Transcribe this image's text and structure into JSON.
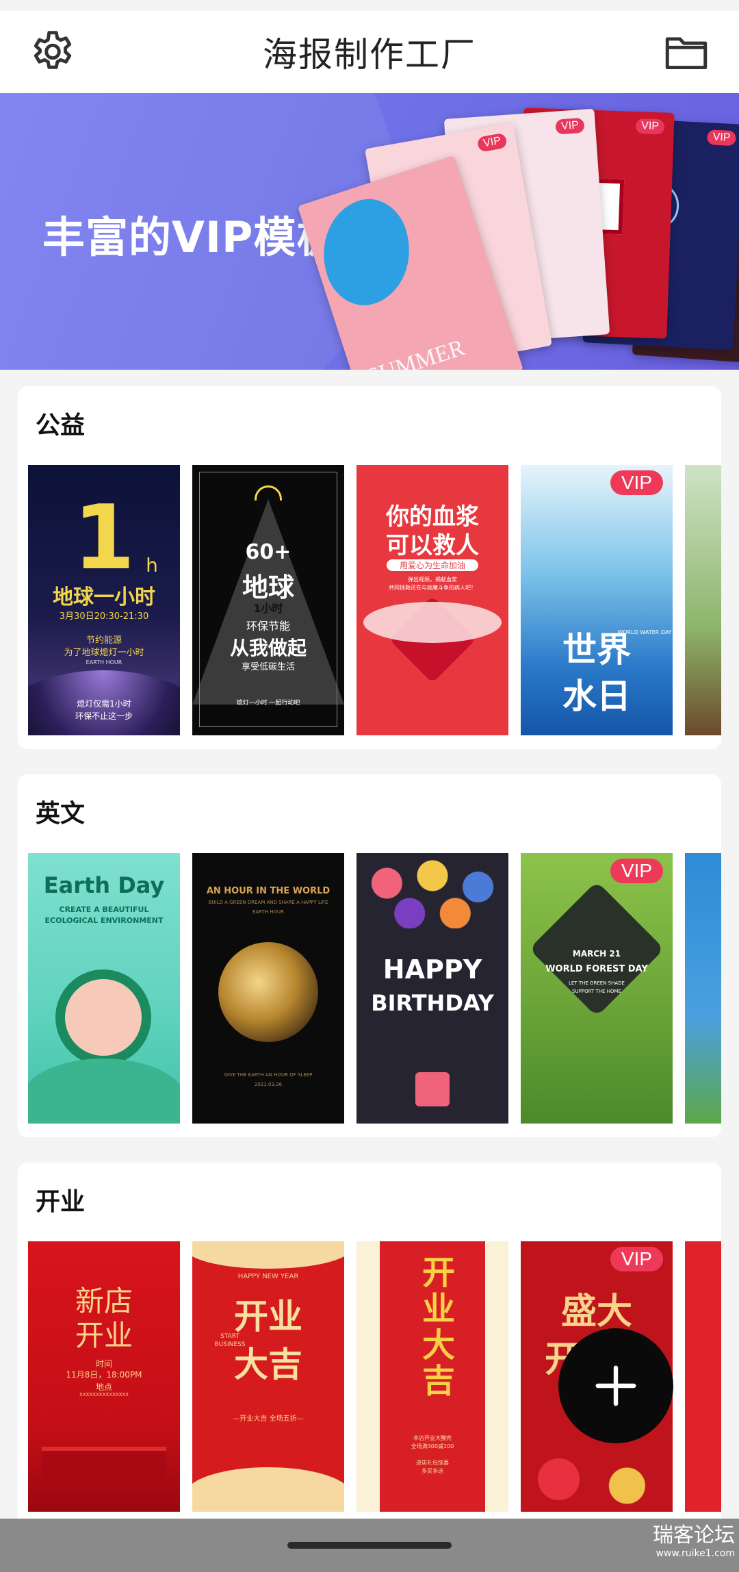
{
  "app": {
    "title": "海报制作工厂"
  },
  "banner": {
    "headline": "丰富的VIP模板",
    "vip_badge": "VIP"
  },
  "sections": [
    {
      "title": "公益",
      "cards": [
        {
          "name": "earth-hour",
          "big": "1",
          "small": "h",
          "line1": "地球一小时",
          "date": "3月30日20:30-21:30",
          "sub1": "节约能源",
          "sub2": "为了地球熄灯一小时",
          "tag": "EARTH HOUR",
          "foot1": "熄灯仅需1小时",
          "foot2": "环保不止这一步"
        },
        {
          "name": "sixty-plus",
          "l1": "60+",
          "l2": "地球",
          "l3": "1小时",
          "l4": "环保节能",
          "l5": "从我做起",
          "l6": "享受低碳生活",
          "l7": "熄灯一小时 一起行动吧"
        },
        {
          "name": "blood-donation",
          "l1": "你的血浆",
          "l2": "可以救人",
          "l3": "用爱心为生命加油",
          "l4": "弹出视频，揭献血浆",
          "l5": "共同拯救还在与病魔斗争的病人吧！"
        },
        {
          "name": "world-water-day",
          "vip": "VIP",
          "l1": "世界",
          "l2": "水日",
          "side": "WORLD WATER DAY"
        }
      ]
    },
    {
      "title": "英文",
      "cards": [
        {
          "name": "earth-day",
          "l1": "Earth Day",
          "l2": "CREATE A BEAUTIFUL",
          "l3": "ECOLOGICAL ENVIRONMENT"
        },
        {
          "name": "hour-in-world",
          "l1": "AN HOUR IN THE WORLD",
          "l2": "BUILD A GREEN DREAM AND SHARE A HAPPY LIFE",
          "l3": "EARTH HOUR",
          "l4": "GIVE THE EARTH AN HOUR OF SLEEP",
          "l5": "2021.03.26"
        },
        {
          "name": "happy-birthday",
          "l1": "HAPPY",
          "l2": "BIRTHDAY"
        },
        {
          "name": "world-forest-day",
          "vip": "VIP",
          "l1": "MARCH 21",
          "l2": "WORLD FOREST DAY",
          "l3": "LET THE GREEN SHADE",
          "l4": "SUPPORT THE HOME"
        }
      ]
    },
    {
      "title": "开业",
      "cards": [
        {
          "name": "new-store",
          "l1": "新店",
          "l2": "开业",
          "l3": "时间",
          "l4": "11月8日，18:00PM",
          "l5": "地点",
          "l6": "XXXXXXXXXXXXXXX"
        },
        {
          "name": "grand-opening-1",
          "l0": "HAPPY NEW YEAR",
          "l1": "开业",
          "l2": "大吉",
          "l3": "START",
          "l4": "BUSINESS",
          "l5": "—开业大吉 全场五折—"
        },
        {
          "name": "grand-opening-2",
          "l1": "开业大吉",
          "l2": "本店开业大酬宾",
          "l3": "全场满300减100",
          "l4": "进店礼包惊喜",
          "l5": "多买多送"
        },
        {
          "name": "grand-open-vip",
          "vip": "VIP",
          "l1": "盛大",
          "l2": "开"
        }
      ]
    }
  ],
  "watermark": {
    "title": "瑞客论坛",
    "url": "www.ruike1.com"
  },
  "icons": {
    "settings": "gear-icon",
    "files": "folder-icon",
    "add": "plus-icon"
  }
}
